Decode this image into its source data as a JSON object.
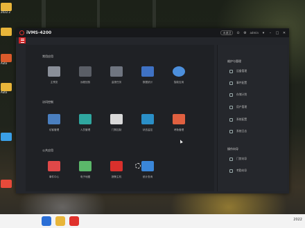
{
  "desktop": {
    "icons": [
      {
        "label": "2022.2",
        "color": "#e8b53a"
      },
      {
        "label": "",
        "color": "#e8b53a"
      },
      {
        "label": "Auto",
        "color": "#d95a2b"
      },
      {
        "label": "Auto",
        "color": "#e8b53a"
      },
      {
        "label": "",
        "color": "#3aa0e8"
      },
      {
        "label": "",
        "color": "#e84a3a"
      }
    ],
    "taskbar": {
      "tray_text": "2022"
    }
  },
  "app": {
    "title": "iVMS-4200",
    "titlebar": {
      "status_label": "未激活",
      "user": "admin"
    },
    "sections": {
      "general": {
        "title": "常用应用",
        "tiles": [
          {
            "label": "主预览",
            "icon": "camera-icon",
            "color": "#8a8f99"
          },
          {
            "label": "远程回放",
            "icon": "playback-icon",
            "color": "#5a5e66"
          },
          {
            "label": "监视任务",
            "icon": "monitor-icon",
            "color": "#6f7580"
          },
          {
            "label": "数据统计",
            "icon": "statistics-icon",
            "color": "#3f72c4"
          },
          {
            "label": "智能应用",
            "icon": "smart-camera-icon",
            "color": "#4c8fdc"
          }
        ]
      },
      "access": {
        "title": "访问控制",
        "tiles": [
          {
            "label": "访客管理",
            "icon": "visitor-icon",
            "color": "#4a7fc0"
          },
          {
            "label": "人员管理",
            "icon": "people-icon",
            "color": "#2fa7a0"
          },
          {
            "label": "门禁控制",
            "icon": "door-control-icon",
            "color": "#d9d9d9"
          },
          {
            "label": "状态监控",
            "icon": "status-monitor-icon",
            "color": "#2a8fc7"
          },
          {
            "label": "考勤管理",
            "icon": "attendance-icon",
            "color": "#e06040"
          }
        ]
      },
      "public": {
        "title": "公共应用",
        "tiles": [
          {
            "label": "事件中心",
            "icon": "event-center-icon",
            "color": "#e04848"
          },
          {
            "label": "电子地图",
            "icon": "map-icon",
            "color": "#5bb86a"
          },
          {
            "label": "报警主机",
            "icon": "alarm-host-icon",
            "color": "#d9302c"
          },
          {
            "label": "统计查询",
            "icon": "query-icon",
            "color": "#3a86d8"
          }
        ]
      }
    },
    "sidebar": {
      "maintenance": {
        "title": "维护与管理",
        "items": [
          "设备管理",
          "事件配置",
          "存储计划",
          "用户管理",
          "系统配置",
          "系统日志"
        ]
      },
      "guide": {
        "title": "操作向导",
        "items": [
          "门禁向导",
          "考勤向导"
        ]
      }
    }
  }
}
